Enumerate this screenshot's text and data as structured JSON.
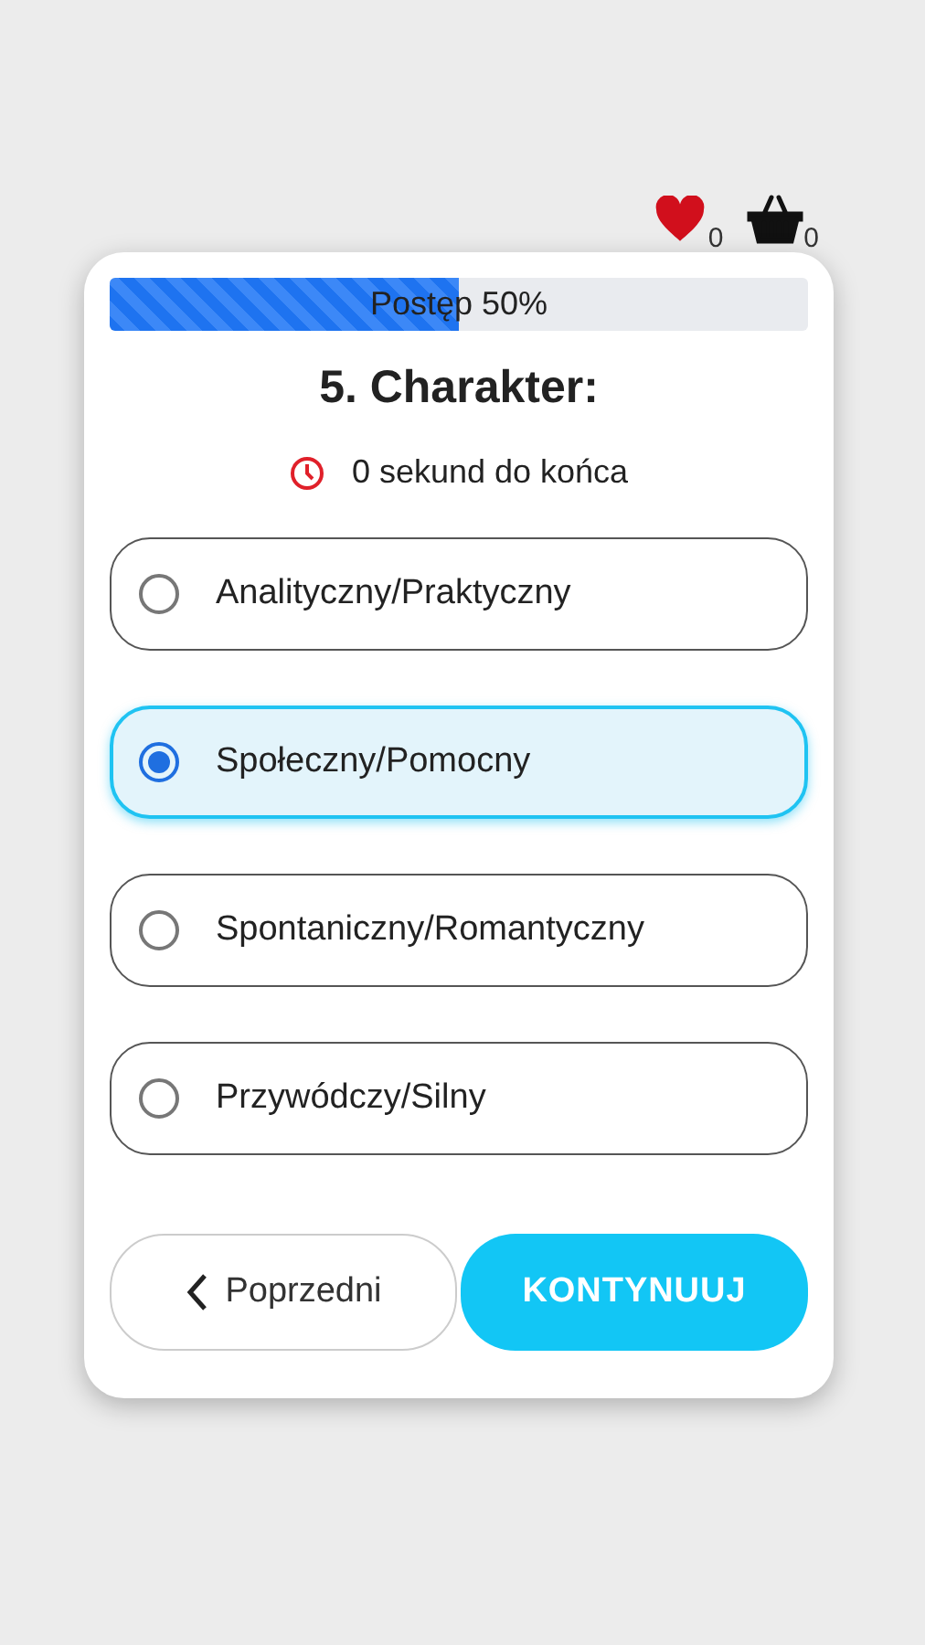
{
  "header": {
    "favorites_count": "0",
    "basket_count": "0"
  },
  "progress": {
    "label": "Postęp 50%",
    "level": 0.5
  },
  "question": {
    "title": "5. Charakter:",
    "timer": "0 sekund do końca"
  },
  "options": [
    {
      "label": "Analityczny/Praktyczny",
      "selected": false
    },
    {
      "label": "Społeczny/Pomocny",
      "selected": true
    },
    {
      "label": "Spontaniczny/Romantyczny",
      "selected": false
    },
    {
      "label": "Przywódczy/Silny",
      "selected": false
    }
  ],
  "buttons": {
    "previous": "Poprzedni",
    "continue": "KONTYNUUJ"
  }
}
